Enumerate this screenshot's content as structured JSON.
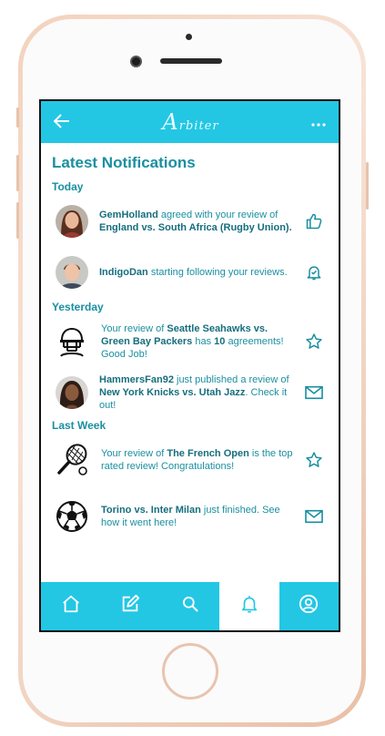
{
  "app": {
    "logo_initial": "A",
    "logo_rest": "rbiter",
    "back_icon": "back-arrow-icon",
    "more_icon": "more-dots-icon"
  },
  "page_title": "Latest Notifications",
  "sections": {
    "today": "Today",
    "yesterday": "Yesterday",
    "last_week": "Last Week"
  },
  "notifications": [
    {
      "user": "GemHolland",
      "text1": " agreed with your review of ",
      "bold2": "England vs. South Africa (Rugby Union).",
      "action_icon": "thumbs-up-icon"
    },
    {
      "user": "IndigoDan",
      "text1": " starting following your reviews.",
      "action_icon": "bell-check-icon"
    },
    {
      "text0": "Your review of ",
      "bold1": "Seattle Seahawks vs. Green Bay Packers",
      "text1": " has ",
      "bold2": "10",
      "text2": " agreements! Good Job!",
      "action_icon": "star-icon"
    },
    {
      "user": "HammersFan92",
      "text1": " just published a review of ",
      "bold2": "New York Knicks vs. Utah Jazz",
      "text2": ". Check it out!",
      "action_icon": "mail-icon"
    },
    {
      "text0": "Your review of ",
      "bold1": "The French Open",
      "text1": " is the top rated review! Congratulations!",
      "action_icon": "star-icon"
    },
    {
      "bold1": "Torino vs. Inter Milan",
      "text1": " just finished. See how it went here!",
      "action_icon": "mail-icon"
    }
  ],
  "nav": [
    {
      "icon": "home-icon"
    },
    {
      "icon": "edit-icon"
    },
    {
      "icon": "search-icon"
    },
    {
      "icon": "bell-icon",
      "active": true
    },
    {
      "icon": "profile-icon"
    }
  ],
  "colors": {
    "accent": "#23c7e4",
    "text": "#1a8fa0"
  }
}
